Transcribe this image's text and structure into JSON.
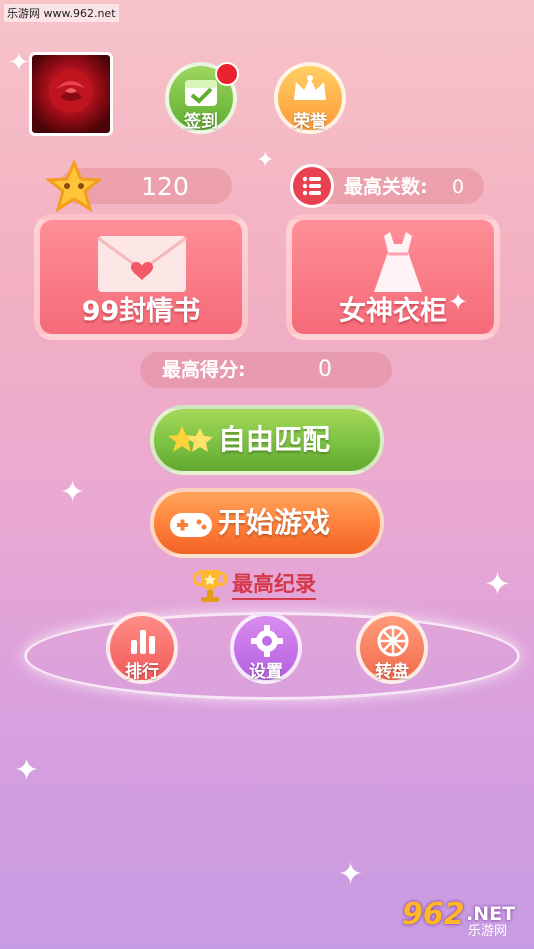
{
  "watermark": "乐游网 www.962.net",
  "profile": {
    "avatar_name": "rose-avatar"
  },
  "top_buttons": {
    "signin_label": "签到",
    "honor_label": "荣誉"
  },
  "stars": {
    "count": "120"
  },
  "max_level": {
    "label": "最高关数:",
    "value": "0"
  },
  "cards": {
    "letters_label": "99封情书",
    "wardrobe_label": "女神衣柜"
  },
  "best_score": {
    "label": "最高得分:",
    "value": "0"
  },
  "main_buttons": {
    "free_match_label": "自由匹配",
    "start_game_label": "开始游戏"
  },
  "record": {
    "label": "最高纪录"
  },
  "bottom_buttons": {
    "rank_label": "排行",
    "settings_label": "设置",
    "wheel_label": "转盘"
  },
  "brand": {
    "number": "962",
    "net": ".NET",
    "sub": "乐游网"
  },
  "colors": {
    "green": "#7cc242",
    "orange": "#ff7f3a",
    "pink": "#f56a78",
    "accent_red": "#e8414f"
  }
}
